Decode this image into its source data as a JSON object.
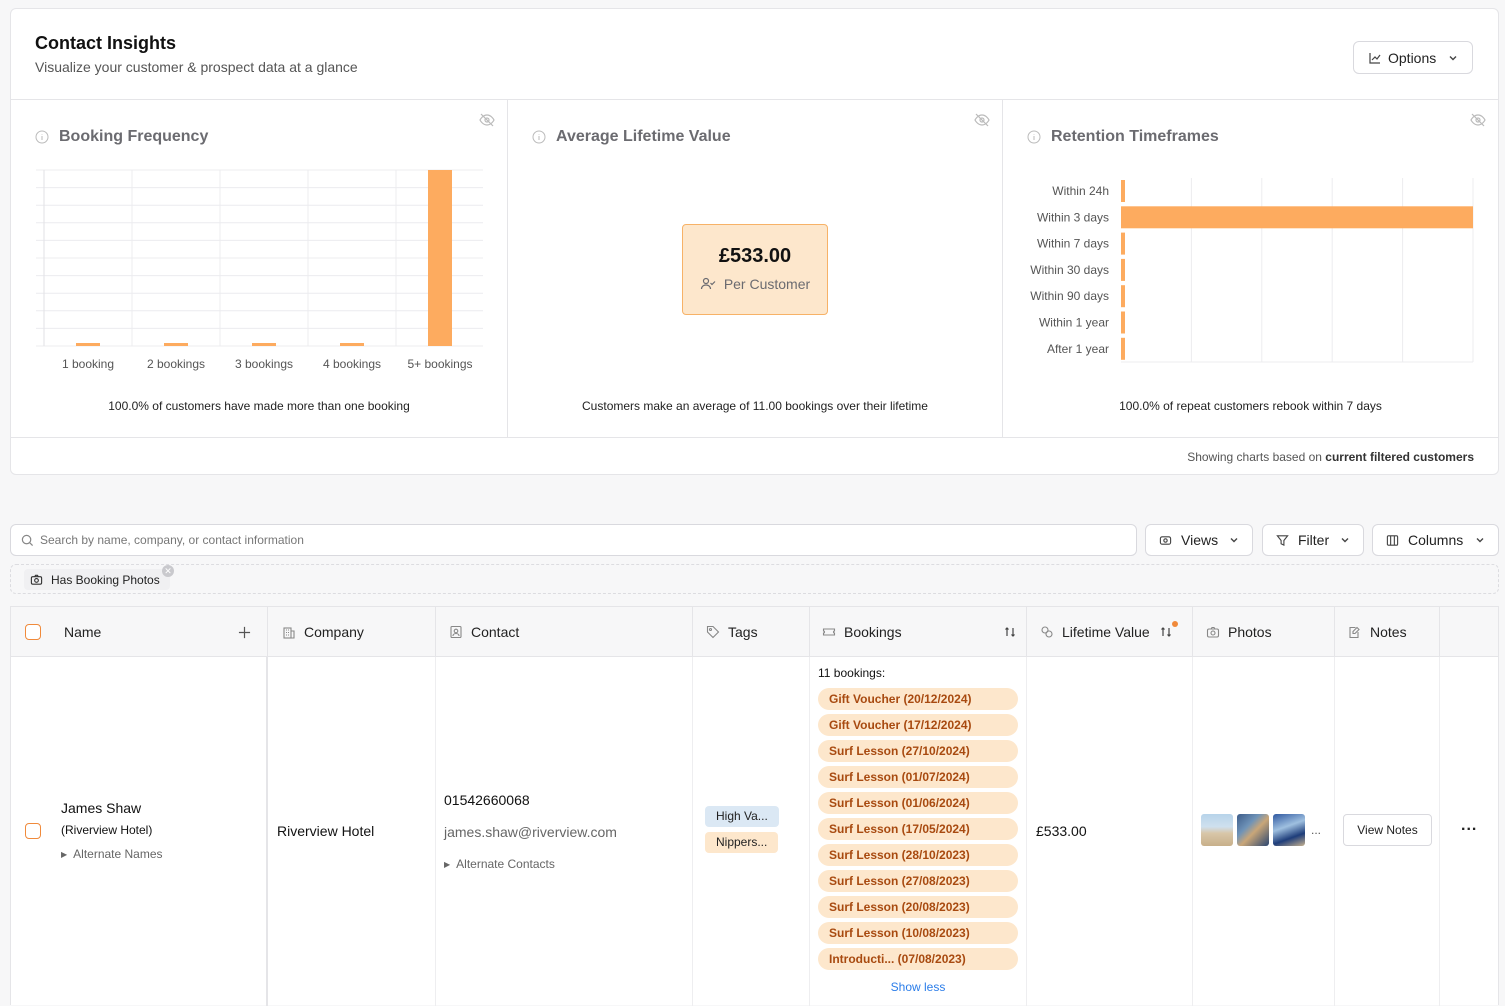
{
  "insights": {
    "title": "Contact Insights",
    "subtitle": "Visualize your customer & prospect data at a glance",
    "options_label": "Options",
    "footer_prefix": "Showing charts based on ",
    "footer_bold": "current filtered customers"
  },
  "booking_frequency": {
    "title": "Booking Frequency",
    "summary": "100.0% of customers have made more than one booking",
    "chart_data": {
      "type": "bar",
      "categories": [
        "1 booking",
        "2 bookings",
        "3 bookings",
        "4 bookings",
        "5+ bookings"
      ],
      "values": [
        0,
        0,
        0,
        0,
        1
      ],
      "color": "#fdab5f"
    }
  },
  "lifetime_value": {
    "title": "Average Lifetime Value",
    "value": "£533.00",
    "label": "Per Customer",
    "summary": "Customers make an average of 11.00 bookings over their lifetime"
  },
  "retention": {
    "title": "Retention Timeframes",
    "summary": "100.0% of repeat customers rebook within 7 days",
    "chart_data": {
      "type": "bar",
      "orientation": "horizontal",
      "categories": [
        "Within 24h",
        "Within 3 days",
        "Within 7 days",
        "Within 30 days",
        "Within 90 days",
        "Within 1 year",
        "After 1 year"
      ],
      "values": [
        0,
        1,
        0,
        0,
        0,
        0,
        0
      ],
      "color": "#fdab5f"
    }
  },
  "toolbar": {
    "search_placeholder": "Search by name, company, or contact information",
    "views_label": "Views",
    "filter_label": "Filter",
    "columns_label": "Columns"
  },
  "active_filter": "Has Booking Photos",
  "table": {
    "headers": {
      "name": "Name",
      "company": "Company",
      "contact": "Contact",
      "tags": "Tags",
      "bookings": "Bookings",
      "lifetime_value": "Lifetime Value",
      "photos": "Photos",
      "notes": "Notes"
    },
    "row": {
      "name": "James Shaw",
      "name_sub": "(Riverview Hotel)",
      "alternate_names": "Alternate Names",
      "company": "Riverview Hotel",
      "phone": "01542660068",
      "email": "james.shaw@riverview.com",
      "alternate_contacts": "Alternate Contacts",
      "tags": [
        "High Va...",
        "Nippers..."
      ],
      "bookings_count": "11 bookings:",
      "bookings": [
        "Gift Voucher (20/12/2024)",
        "Gift Voucher (17/12/2024)",
        "Surf Lesson (27/10/2024)",
        "Surf Lesson (01/07/2024)",
        "Surf Lesson (01/06/2024)",
        "Surf Lesson (17/05/2024)",
        "Surf Lesson (28/10/2023)",
        "Surf Lesson (27/08/2023)",
        "Surf Lesson (20/08/2023)",
        "Surf Lesson (10/08/2023)",
        "Introducti... (07/08/2023)"
      ],
      "show_less": "Show less",
      "lifetime_value": "£533.00",
      "photos_more": "...",
      "view_notes": "View Notes",
      "more_actions": "..."
    }
  },
  "colors": {
    "accent": "#fdab5f",
    "booking_tag_bg": "#fde7cc",
    "booking_tag_text": "#a84a10",
    "tag_blue": "#dbe8f4",
    "tag_orange": "#fde7cc"
  }
}
